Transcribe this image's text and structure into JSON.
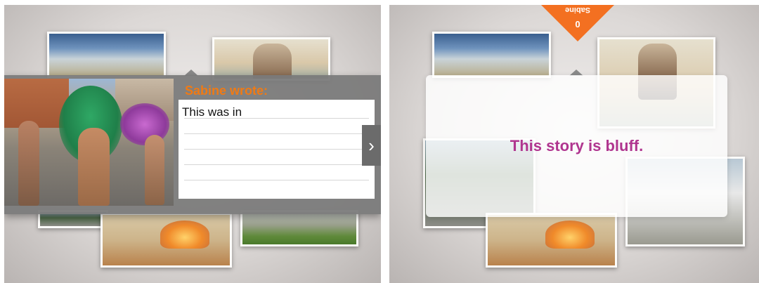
{
  "left_screen": {
    "author_heading": "Sabine wrote:",
    "story_text": "This was in",
    "next_button_glyph": "›",
    "next_icon": "chevron-right-icon"
  },
  "right_screen": {
    "player": {
      "name": "Sabine",
      "score": "0"
    },
    "verdict": "This story is bluff."
  },
  "colors": {
    "accent_orange": "#f37021",
    "heading_orange": "#f07a14",
    "verdict_magenta": "#b0358f"
  }
}
